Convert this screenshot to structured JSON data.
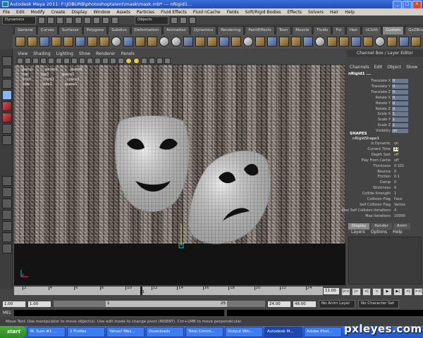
{
  "window": {
    "title": "Autodesk Maya 2011: F:\\JOBURB\\photoshoptalent\\mask\\mask.mb*  ---  nRigid1..."
  },
  "menubar": [
    "File",
    "Edit",
    "Modify",
    "Create",
    "Display",
    "Window",
    "Assets",
    "Particles",
    "Fluid Effects",
    "Fluid nCache",
    "Fields",
    "Soft/Rigid Bodies",
    "Effects",
    "Solvers",
    "Hair",
    "Help"
  ],
  "statusline": {
    "menuset": "Dynamics",
    "objects_field": "Objects"
  },
  "shelf_tabs": {
    "active": "Custom",
    "items": [
      "General",
      "Curves",
      "Surfaces",
      "Polygons",
      "Subdivs",
      "Deformation",
      "Animation",
      "Dynamics",
      "Rendering",
      "PaintEffects",
      "Toon",
      "Muscle",
      "Fluids",
      "Fur",
      "Hair",
      "nCloth",
      "Custom",
      "GoZBrush"
    ]
  },
  "panel_menu": [
    "View",
    "Shading",
    "Lighting",
    "Show",
    "Renderer",
    "Panels"
  ],
  "outliner_overlay": [
    [
      "persp",
      "persp1",
      "space1"
    ],
    [
      "top",
      "top1",
      "space1"
    ],
    [
      "front",
      "front1",
      "space1"
    ],
    [
      "side",
      "side1",
      "space1"
    ]
  ],
  "channel_box": {
    "title": "Channel Box / Layer Editor",
    "menu": [
      "Channels",
      "Edit",
      "Object",
      "Show"
    ],
    "object": "nRigid1 ...",
    "attributes": [
      {
        "name": "Translate X",
        "value": "0"
      },
      {
        "name": "Translate Y",
        "value": "0"
      },
      {
        "name": "Translate Z",
        "value": "0"
      },
      {
        "name": "Rotate X",
        "value": "0"
      },
      {
        "name": "Rotate Y",
        "value": "0"
      },
      {
        "name": "Rotate Z",
        "value": "0"
      },
      {
        "name": "Scale X",
        "value": "1"
      },
      {
        "name": "Scale Y",
        "value": "1"
      },
      {
        "name": "Scale Z",
        "value": "1"
      },
      {
        "name": "Visibility",
        "value": "on"
      }
    ],
    "shapes_heading": "SHAPES",
    "shape_name": "nRigidShape1",
    "shape_attributes": [
      {
        "name": "Is Dynamic",
        "value": "on"
      },
      {
        "name": "Current Time",
        "value": "11",
        "highlight": true
      },
      {
        "name": "Depth Sort",
        "value": "off"
      },
      {
        "name": "Play From Cache",
        "value": "off"
      },
      {
        "name": "Thickness",
        "value": "0.101"
      },
      {
        "name": "Bounce",
        "value": "0"
      },
      {
        "name": "Friction",
        "value": "0.1"
      },
      {
        "name": "Damp",
        "value": "0"
      },
      {
        "name": "Stickiness",
        "value": "0"
      },
      {
        "name": "Collide Strength",
        "value": "1"
      },
      {
        "name": "Collision Flag",
        "value": "Face"
      },
      {
        "name": "Self Collision Flag",
        "value": "Vertex"
      },
      {
        "name": "Max Self Collision Iterations",
        "value": "4"
      },
      {
        "name": "Max Iterations",
        "value": "10000"
      }
    ]
  },
  "layer_editor": {
    "tabs": [
      "Display",
      "Render",
      "Anim"
    ],
    "active": "Display",
    "menu": [
      "Layers",
      "Options",
      "Help"
    ]
  },
  "time_slider": {
    "ticks": [
      "2",
      "4",
      "6",
      "8",
      "10",
      "12",
      "14",
      "16",
      "18",
      "20",
      "22",
      "24"
    ],
    "current_frame": "11",
    "current_frame_field": "11.00"
  },
  "playback_buttons": [
    "|<<",
    "|<",
    "<|",
    "<",
    "▶",
    "▶|",
    ">|",
    ">>|"
  ],
  "range": {
    "start": "1.00",
    "playback_start": "1.00",
    "handle_start": "1",
    "handle_end": "25",
    "playback_end": "24.00",
    "end": "48.00",
    "anim_layer": "No Anim Layer",
    "character_set": "No Character Set"
  },
  "cmdline": {
    "label": "MEL"
  },
  "helpline": "Move Tool: Use manipulator to move object(s). Use edit mode to change pivot (INSERT). Ctrl+LMB to move perpendicular.",
  "taskbar": {
    "start": "start",
    "tasks": [
      "M. Sum #1 ...",
      "2 Firefox",
      "Yahoo! Mes...",
      "Downloads",
      "Total Comm...",
      "Output Win...",
      "Autodesk M...",
      "Adobe Phot..."
    ],
    "active_index": 6
  },
  "watermark": "pxleyes.com"
}
